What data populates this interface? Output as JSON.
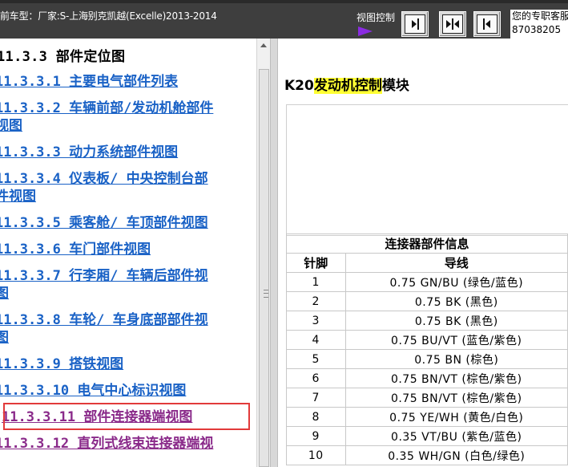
{
  "header": {
    "vehicle_text": "前车型：厂家:S-上海别克凯越(Excelle)2013-2014",
    "view_control_label": "视图控制",
    "buttons": [
      {
        "name": "view-right"
      },
      {
        "name": "view-split"
      },
      {
        "name": "view-left"
      }
    ],
    "support_line1": "您的专职客服",
    "support_line2": "87038205"
  },
  "toc": {
    "heading": "11.3.3 部件定位图",
    "items": [
      {
        "line1": "11.3.3.1 主要电气部件列表",
        "line2": "",
        "visited": false
      },
      {
        "line1": "11.3.3.2 车辆前部/发动机舱部件",
        "line2": "视图",
        "visited": false
      },
      {
        "line1": "11.3.3.3 动力系统部件视图",
        "line2": "",
        "visited": false
      },
      {
        "line1": "11.3.3.4 仪表板/ 中央控制台部",
        "line2": "件视图",
        "visited": false
      },
      {
        "line1": "11.3.3.5 乘客舱/ 车顶部件视图",
        "line2": "",
        "visited": false
      },
      {
        "line1": "11.3.3.6 车门部件视图",
        "line2": "",
        "visited": false
      },
      {
        "line1": "11.3.3.7 行李厢/ 车辆后部件视",
        "line2": "图",
        "visited": false
      },
      {
        "line1": "11.3.3.8 车轮/ 车身底部部件视",
        "line2": "图",
        "visited": false
      },
      {
        "line1": "11.3.3.9 搭铁视图",
        "line2": "",
        "visited": false
      },
      {
        "line1": "11.3.3.10 电气中心标识视图",
        "line2": "",
        "visited": false
      },
      {
        "line1": "11.3.3.11 部件连接器端视图",
        "line2": "",
        "visited": true
      },
      {
        "line1": "11.3.3.12 直列式线束连接器端视",
        "line2": "",
        "visited": true
      }
    ]
  },
  "module": {
    "title_prefix": "K20",
    "title_highlight": "发动机控制",
    "title_suffix": "模块"
  },
  "connector": {
    "info_header": "连接器部件信息",
    "col_pin": "针脚",
    "col_wire": "导线",
    "rows": [
      {
        "pin": "1",
        "wire": "0.75 GN/BU (绿色/蓝色)"
      },
      {
        "pin": "2",
        "wire": "0.75 BK (黑色)"
      },
      {
        "pin": "3",
        "wire": "0.75 BK (黑色)"
      },
      {
        "pin": "4",
        "wire": "0.75 BU/VT (蓝色/紫色)"
      },
      {
        "pin": "5",
        "wire": "0.75 BN (棕色)"
      },
      {
        "pin": "6",
        "wire": "0.75 BN/VT (棕色/紫色)"
      },
      {
        "pin": "7",
        "wire": "0.75 BN/VT (棕色/紫色)"
      },
      {
        "pin": "8",
        "wire": "0.75 YE/WH (黄色/白色)"
      },
      {
        "pin": "9",
        "wire": "0.35 VT/BU (紫色/蓝色)"
      },
      {
        "pin": "10",
        "wire": "0.35 WH/GN (白色/绿色)"
      }
    ]
  },
  "colors": {
    "topbar": "#3e3e3e",
    "link": "#1a62c6",
    "visited_link": "#8a2a8a",
    "highlight_box": "#e23a3a",
    "title_highlight": "#ffff33",
    "view_arrow": "#8a2be2"
  }
}
